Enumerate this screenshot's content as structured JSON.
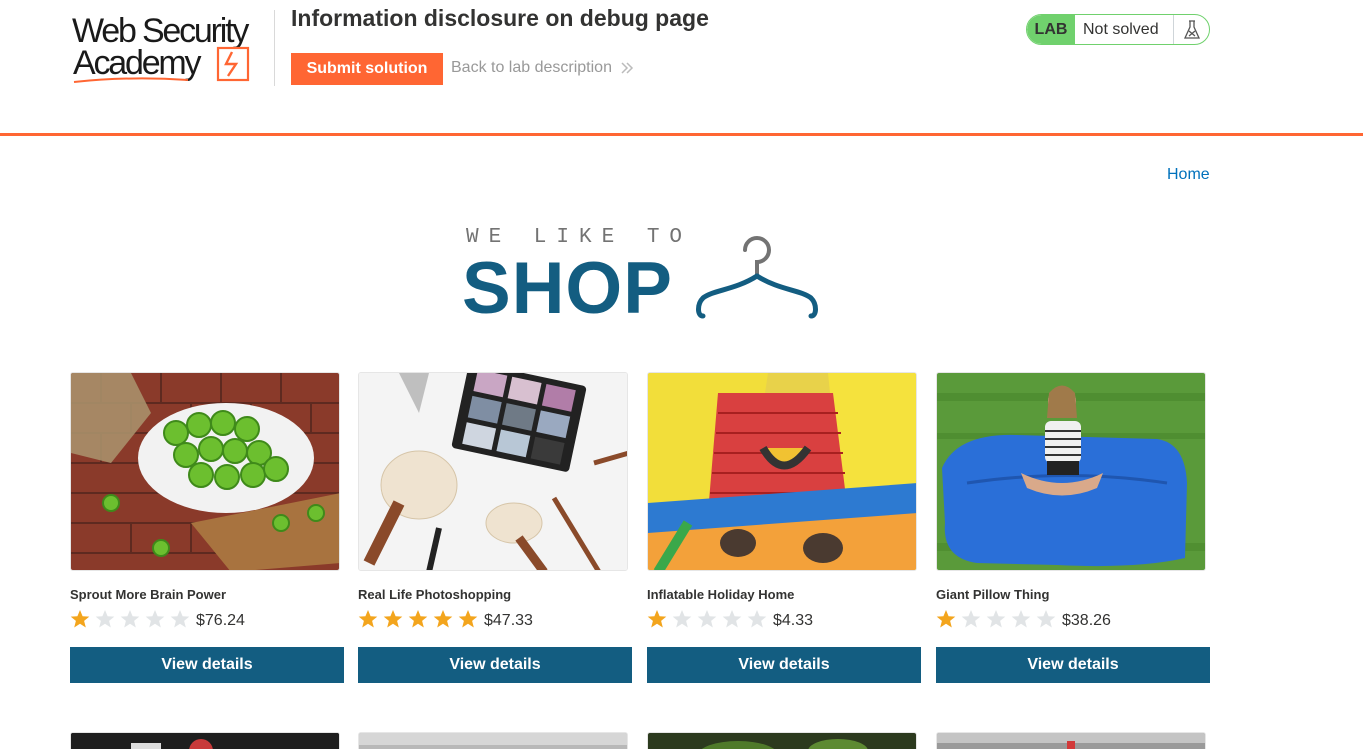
{
  "lab": {
    "logo_line1": "Web Security",
    "logo_line2": "Academy",
    "title": "Information disclosure on debug page",
    "submit_label": "Submit solution",
    "back_label": "Back to lab description",
    "status_badge": "LAB",
    "status_text": "Not solved"
  },
  "nav": {
    "home_label": "Home"
  },
  "banner": {
    "tagline": "WE LIKE TO",
    "headline": "SHOP"
  },
  "products": [
    {
      "name": "Sprout More Brain Power",
      "rating": 1,
      "price": "$76.24",
      "button": "View details",
      "image": "brussels-sprouts-photo"
    },
    {
      "name": "Real Life Photoshopping",
      "rating": 5,
      "price": "$47.33",
      "button": "View details",
      "image": "makeup-brushes-photo"
    },
    {
      "name": "Inflatable Holiday Home",
      "rating": 1,
      "price": "$4.33",
      "button": "View details",
      "image": "bouncy-castle-photo"
    },
    {
      "name": "Giant Pillow Thing",
      "rating": 1,
      "price": "$38.26",
      "button": "View details",
      "image": "giant-pillow-photo"
    }
  ],
  "colors": {
    "accent_orange": "#ff6633",
    "brand_blue": "#135d81",
    "status_green": "#70d16d",
    "link_blue": "#0071bc",
    "star_filled": "#f3a51d",
    "star_empty": "#e1e4e6"
  }
}
